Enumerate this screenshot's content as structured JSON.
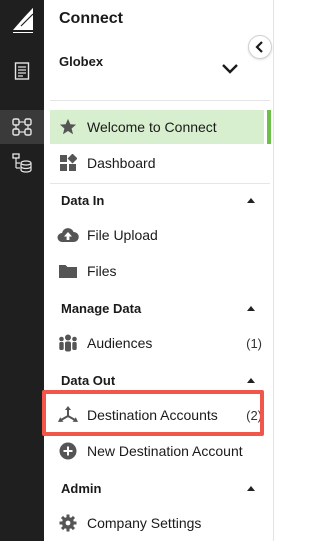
{
  "app": {
    "title": "Connect",
    "org": "Globex"
  },
  "rail": {
    "logo": "sail-logo",
    "buttons": [
      {
        "icon": "document-icon"
      },
      {
        "icon": "nodes-icon",
        "active": true
      },
      {
        "icon": "data-tree-icon"
      }
    ]
  },
  "nav": {
    "welcome": {
      "label": "Welcome to Connect",
      "icon": "star-icon"
    },
    "dashboard": {
      "label": "Dashboard",
      "icon": "dashboard-icon"
    },
    "data_in": {
      "title": "Data In",
      "items": [
        {
          "label": "File Upload",
          "icon": "cloud-upload-icon"
        },
        {
          "label": "Files",
          "icon": "folder-icon"
        }
      ]
    },
    "manage_data": {
      "title": "Manage Data",
      "items": [
        {
          "label": "Audiences",
          "count": "(1)",
          "icon": "people-icon"
        }
      ]
    },
    "data_out": {
      "title": "Data Out",
      "items": [
        {
          "label": "Destination Accounts",
          "count": "(2)",
          "icon": "share-arrows-icon"
        },
        {
          "label": "New Destination Account",
          "icon": "plus-circle-icon"
        }
      ]
    },
    "admin": {
      "title": "Admin",
      "items": [
        {
          "label": "Company Settings",
          "icon": "cog-icon"
        }
      ]
    }
  },
  "colors": {
    "rail": "#1f1f1f",
    "selected_bg": "#d7efcf",
    "selected_bar": "#6cc04a",
    "highlight": "#f0564a"
  }
}
